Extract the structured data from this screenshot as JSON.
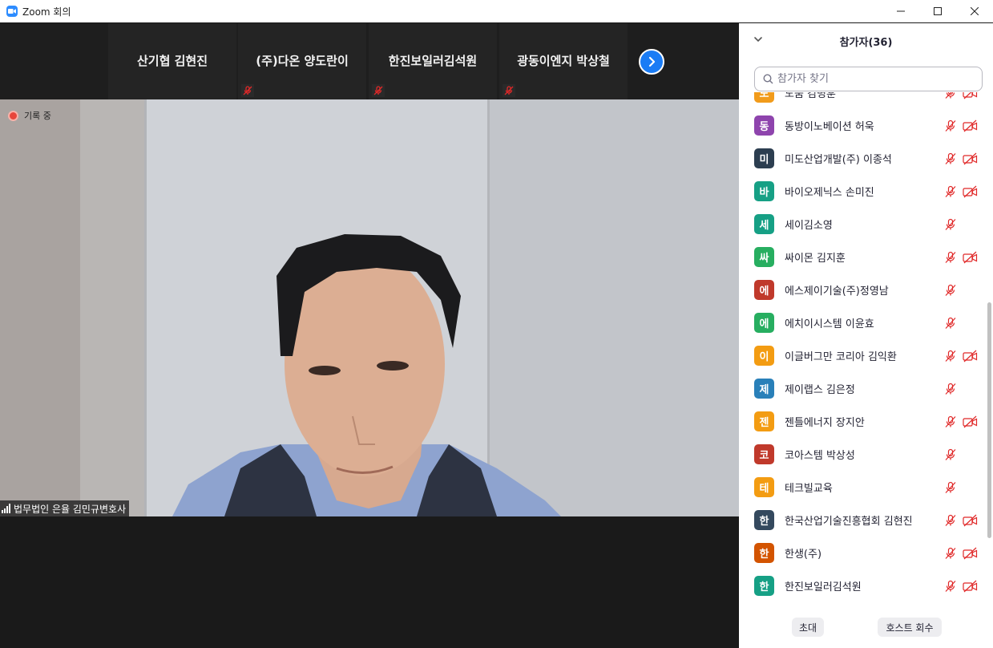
{
  "window": {
    "title": "Zoom 회의"
  },
  "gallery": {
    "tiles": [
      {
        "name": "산기협 김현진",
        "muted": false
      },
      {
        "name": "(주)다온 양도란이",
        "muted": true
      },
      {
        "name": "한진보일러김석원",
        "muted": true
      },
      {
        "name": "광동이엔지 박상철",
        "muted": true
      }
    ]
  },
  "video": {
    "recording_label": "기록 중",
    "speaker_name": "법무법인 은율 김민규변호사"
  },
  "panel": {
    "title": "참가자(36)",
    "search_placeholder": "참가자 찾기",
    "participants": [
      {
        "initial": "도",
        "name": "도움 김병훈",
        "color": "#f19b1b",
        "mic_muted": true,
        "video_off": true
      },
      {
        "initial": "동",
        "name": "동방이노베이션 허욱",
        "color": "#8e44ad",
        "mic_muted": true,
        "video_off": true
      },
      {
        "initial": "미",
        "name": "미도산업개발(주) 이종석",
        "color": "#2c3e50",
        "mic_muted": true,
        "video_off": true
      },
      {
        "initial": "바",
        "name": "바이오제닉스 손미진",
        "color": "#16a085",
        "mic_muted": true,
        "video_off": true
      },
      {
        "initial": "세",
        "name": "세이김소영",
        "color": "#16a085",
        "mic_muted": true,
        "video_off": false
      },
      {
        "initial": "싸",
        "name": "싸이몬 김지훈",
        "color": "#27ae60",
        "mic_muted": true,
        "video_off": true
      },
      {
        "initial": "에",
        "name": "에스제이기술(주)정영남",
        "color": "#c0392b",
        "mic_muted": true,
        "video_off": false
      },
      {
        "initial": "에",
        "name": "에치이시스템 이윤효",
        "color": "#27ae60",
        "mic_muted": true,
        "video_off": false
      },
      {
        "initial": "이",
        "name": "이글버그만 코리아 김익환",
        "color": "#f39c12",
        "mic_muted": true,
        "video_off": true
      },
      {
        "initial": "제",
        "name": "제이랩스 김은정",
        "color": "#2980b9",
        "mic_muted": true,
        "video_off": false
      },
      {
        "initial": "젠",
        "name": "젠틀에너지 장지안",
        "color": "#f39c12",
        "mic_muted": true,
        "video_off": true
      },
      {
        "initial": "코",
        "name": "코아스템 박상성",
        "color": "#c0392b",
        "mic_muted": true,
        "video_off": false
      },
      {
        "initial": "테",
        "name": "테크빌교육",
        "color": "#f39c12",
        "mic_muted": true,
        "video_off": false
      },
      {
        "initial": "한",
        "name": "한국산업기술진흥협회 김현진",
        "color": "#34495e",
        "mic_muted": true,
        "video_off": true
      },
      {
        "initial": "한",
        "name": "한생(주)",
        "color": "#d35400",
        "mic_muted": true,
        "video_off": true
      },
      {
        "initial": "한",
        "name": "한진보일러김석원",
        "color": "#16a085",
        "mic_muted": true,
        "video_off": true
      }
    ],
    "invite_label": "초대",
    "reclaim_host_label": "호스트 회수"
  },
  "icons": {
    "app": "zoom-logo",
    "minimize": "minimize-icon",
    "maximize": "maximize-icon",
    "close": "close-icon",
    "next": "chevron-right-icon",
    "search": "search-icon",
    "mic_muted": "mic-muted-icon",
    "video_off": "video-off-icon"
  },
  "colors": {
    "accent": "#1a7cf5",
    "muted_red": "#e02828",
    "recording": "#e8463b"
  }
}
